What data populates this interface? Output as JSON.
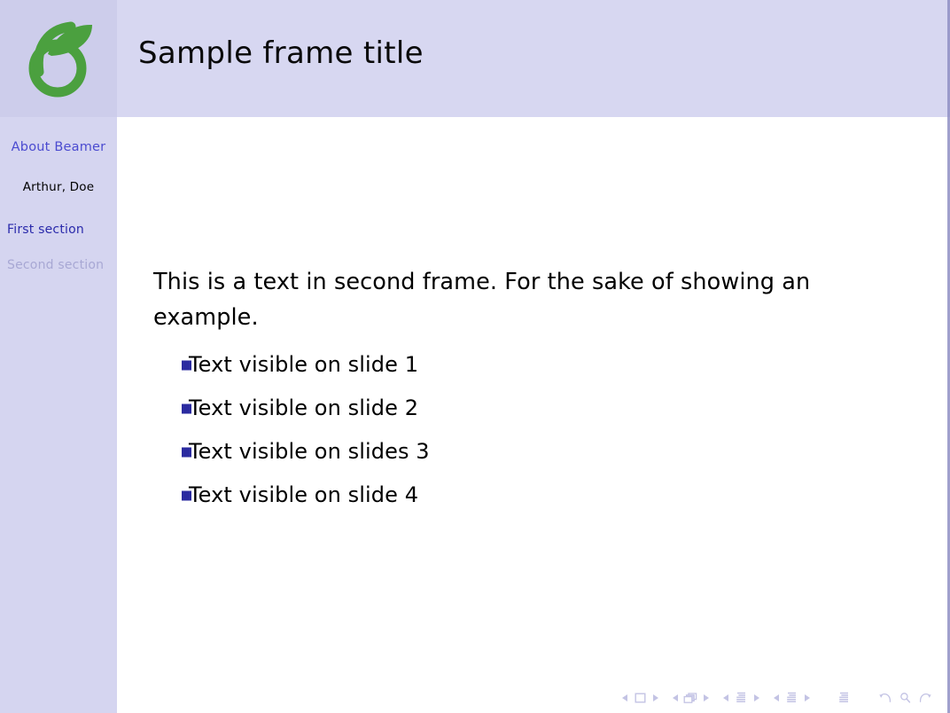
{
  "slide": {
    "frame_title": "Sample frame title",
    "paragraph": "This is a text in second frame. For the sake of showing an example.",
    "items": [
      "Text visible on slide 1",
      "Text visible on slide 2",
      "Text visible on slides 3",
      "Text visible on slide 4"
    ]
  },
  "sidebar": {
    "logo": "sprout-leaf-logo",
    "presentation_title": "About Beamer",
    "authors": "Arthur, Doe",
    "sections": [
      {
        "label": "First section",
        "state": "active"
      },
      {
        "label": "Second section",
        "state": "inactive"
      }
    ]
  },
  "navsymbols": {
    "groups": [
      {
        "name": "slide",
        "prev": "◀",
        "icon": "slide-icon",
        "next": "▶"
      },
      {
        "name": "frame",
        "prev": "◀",
        "icon": "frame-icon",
        "next": "▶"
      },
      {
        "name": "subsection",
        "prev": "◀",
        "icon": "subsection-icon",
        "next": "▶"
      },
      {
        "name": "section",
        "prev": "◀",
        "icon": "section-icon",
        "next": "▶"
      }
    ],
    "presentation_icon": "presentation-icon",
    "back_icon": "back-arrow-icon",
    "search_icon": "search-icon",
    "forward_icon": "forward-arrow-icon"
  },
  "colors": {
    "sidebar_bg": "#d5d5f0",
    "logo_block_bg": "#cdcdeb",
    "header_bg": "#d7d7f1",
    "body_bg": "#ffffff",
    "title_link": "#4b4bd0",
    "section_active": "#2a2aab",
    "section_inactive": "#a8a8d4",
    "bullet": "#2b2ba0",
    "logo_green": "#4ba03f",
    "navsymbol": "#c3c3e4"
  }
}
